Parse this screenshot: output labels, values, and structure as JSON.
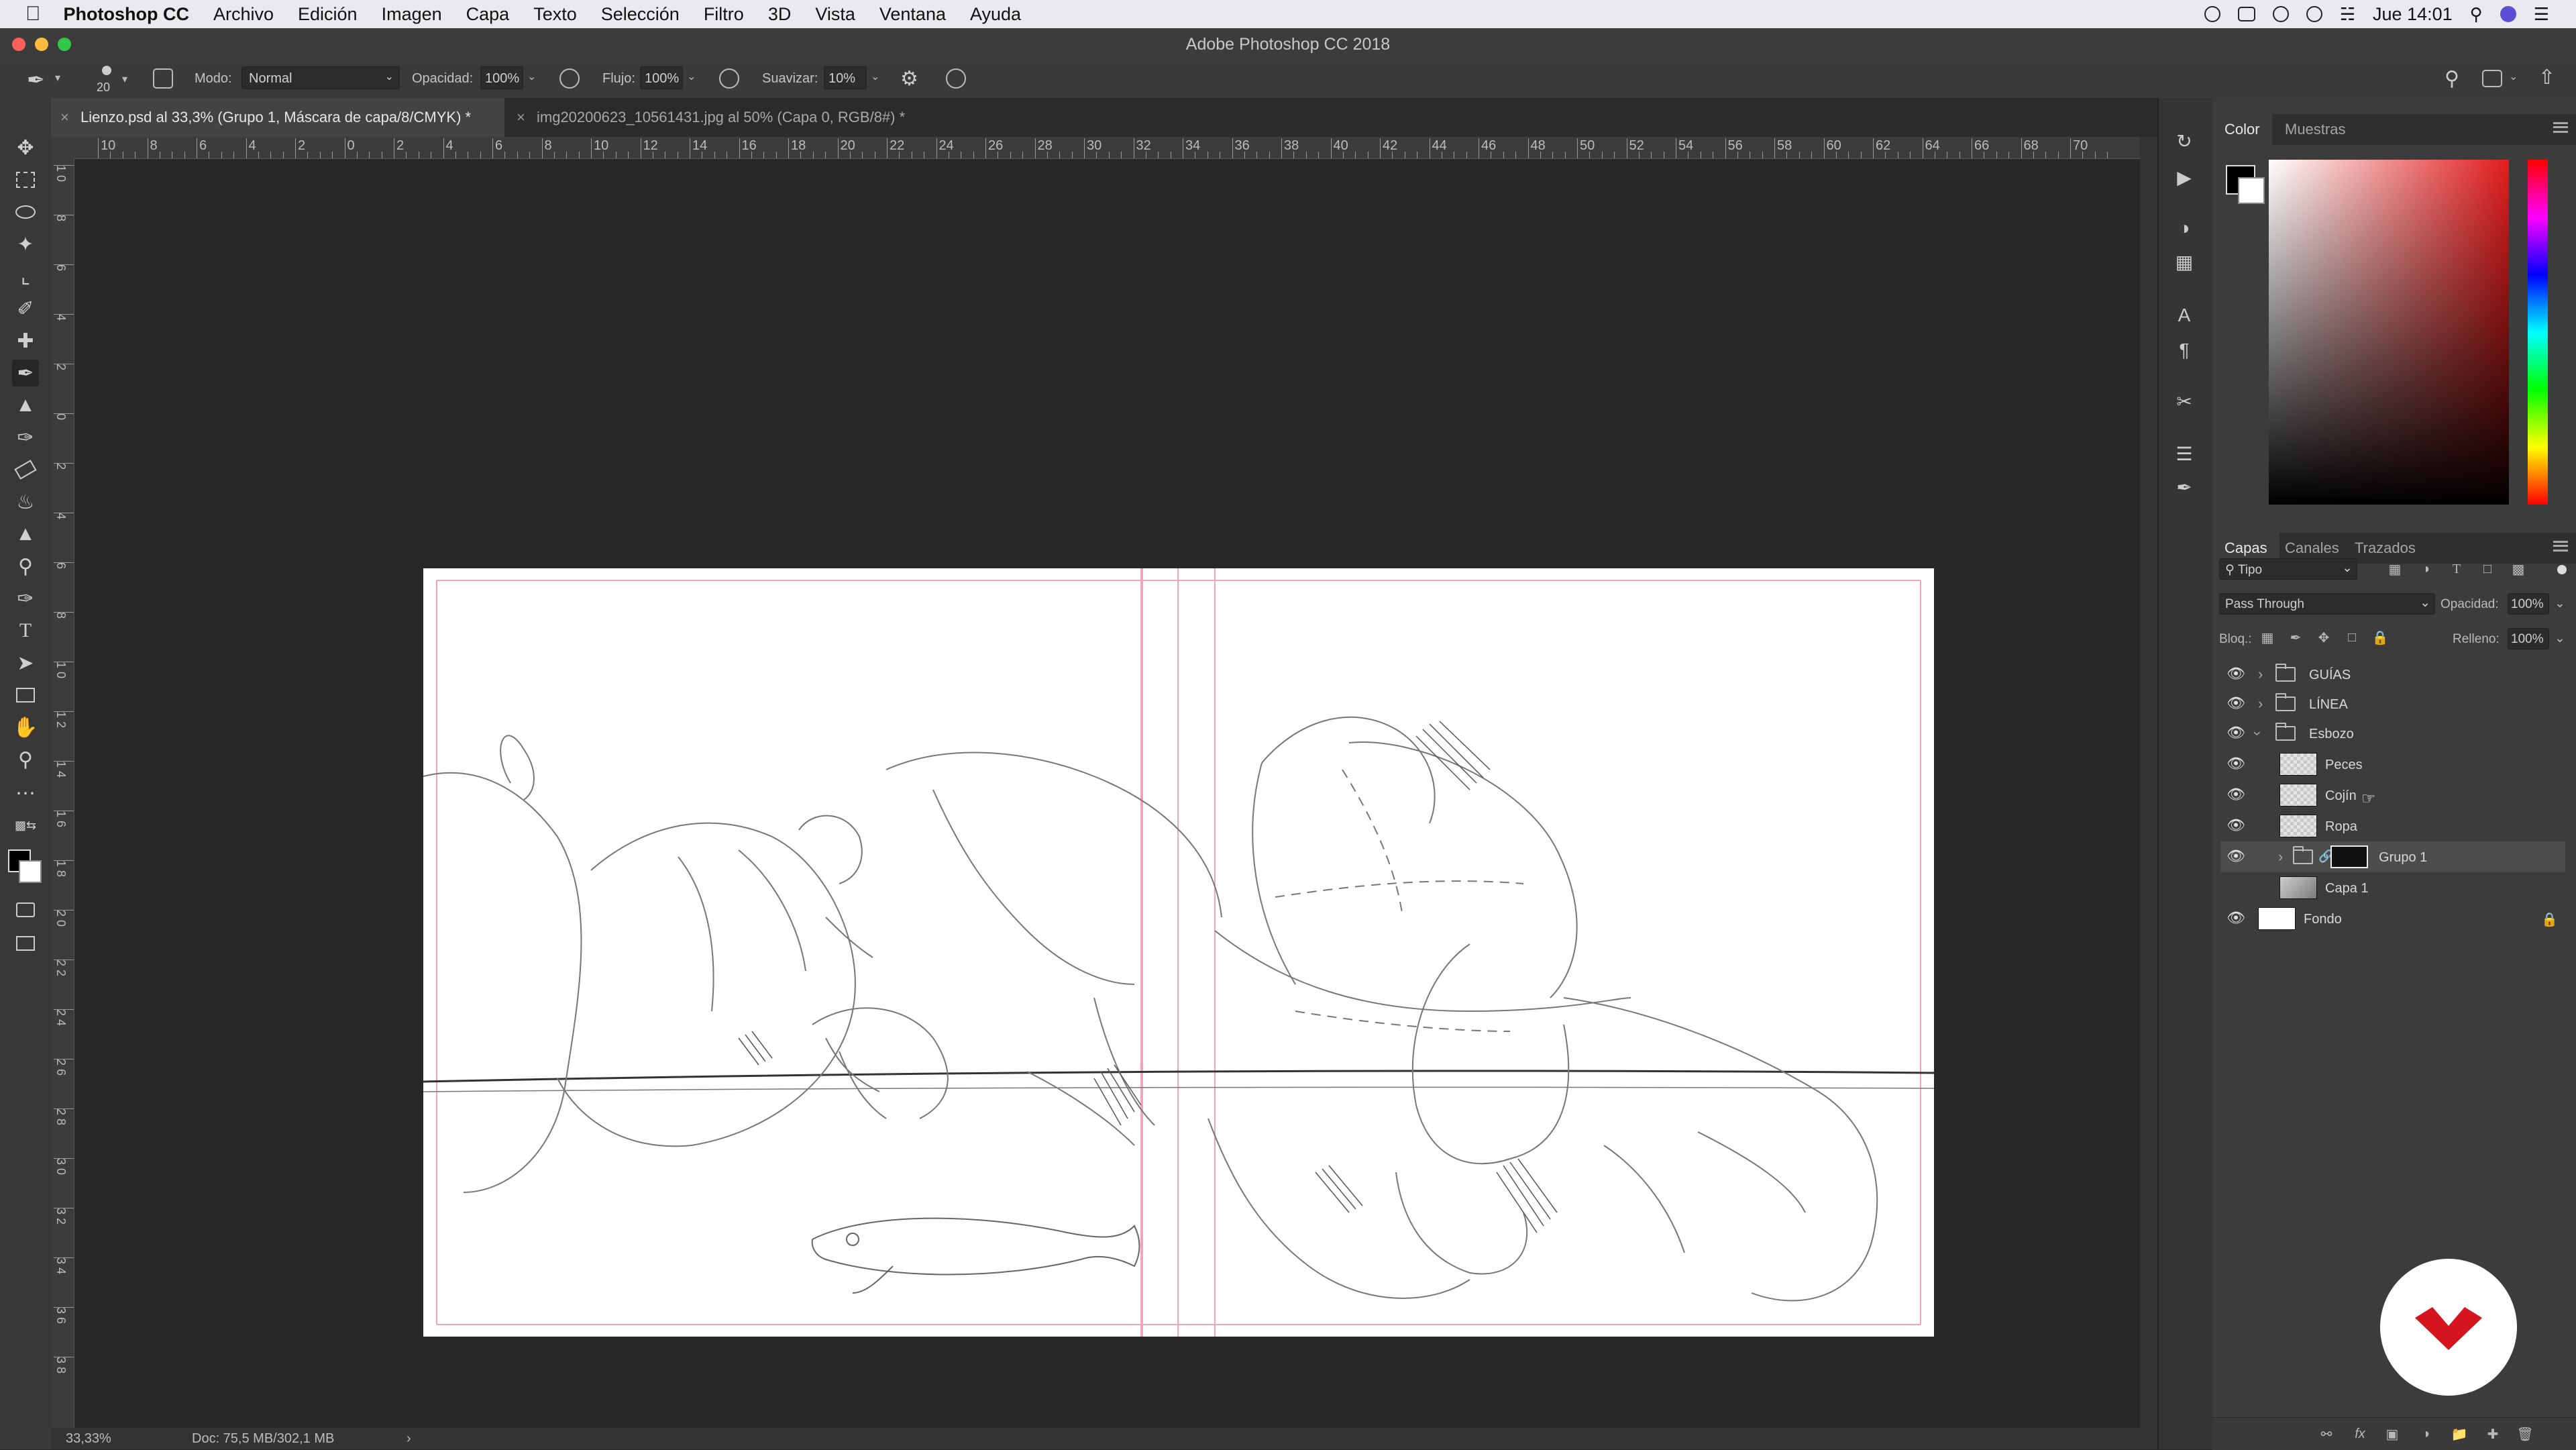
{
  "menubar": {
    "app_name": "Photoshop CC",
    "menus": [
      "Archivo",
      "Edición",
      "Imagen",
      "Capa",
      "Texto",
      "Selección",
      "Filtro",
      "3D",
      "Vista",
      "Ventana",
      "Ayuda"
    ],
    "clock": "Jue 14:01"
  },
  "window": {
    "title": "Adobe Photoshop CC 2018"
  },
  "options_bar": {
    "brush_size": "20",
    "mode_label": "Modo:",
    "mode_value": "Normal",
    "opacity_label": "Opacidad:",
    "opacity_value": "100%",
    "flow_label": "Flujo:",
    "flow_value": "100%",
    "smoothing_label": "Suavizar:",
    "smoothing_value": "10%"
  },
  "tabs": [
    {
      "label": "Lienzo.psd al 33,3% (Grupo 1, Máscara de capa/8/CMYK) *",
      "active": true
    },
    {
      "label": "img20200623_10561431.jpg al 50% (Capa 0, RGB/8#) *",
      "active": false
    }
  ],
  "ruler_top_labels": [
    "10",
    "8",
    "6",
    "4",
    "2",
    "0",
    "2",
    "4",
    "6",
    "8",
    "10",
    "12",
    "14",
    "16",
    "18",
    "20",
    "22",
    "24",
    "26",
    "28",
    "30",
    "32",
    "34",
    "36",
    "38",
    "40",
    "42",
    "44",
    "46",
    "48",
    "50",
    "52",
    "54",
    "56",
    "58",
    "60",
    "62",
    "64",
    "66",
    "68",
    "70"
  ],
  "ruler_left_labels": [
    "1 0",
    "8",
    "6",
    "4",
    "2",
    "0",
    "2",
    "4",
    "6",
    "8",
    "1 0",
    "1 2",
    "1 4",
    "1 6",
    "1 8",
    "2 0",
    "2 2",
    "2 4",
    "2 6",
    "2 8",
    "3 0",
    "3 2",
    "3 4",
    "3 6",
    "3 8"
  ],
  "status_bar": {
    "zoom": "33,33%",
    "doc_size": "Doc: 75,5 MB/302,1 MB"
  },
  "color_panel": {
    "tabs": [
      "Color",
      "Muestras"
    ],
    "foreground": "#000000",
    "background": "#ffffff",
    "hue_color": "#e31d1d"
  },
  "layers_panel": {
    "tabs": [
      "Capas",
      "Canales",
      "Trazados"
    ],
    "filter_kind": "Tipo",
    "blend_mode": "Pass Through",
    "opacity_label": "Opacidad:",
    "opacity_value": "100%",
    "lock_label": "Bloq.:",
    "fill_label": "Relleno:",
    "fill_value": "100%",
    "layers": [
      {
        "name": "GUÍAS",
        "type": "group",
        "visible": true,
        "expanded": false,
        "indent": 0
      },
      {
        "name": "LÍNEA",
        "type": "group",
        "visible": true,
        "expanded": false,
        "indent": 0
      },
      {
        "name": "Esbozo",
        "type": "group",
        "visible": true,
        "expanded": true,
        "indent": 0
      },
      {
        "name": "Peces",
        "type": "layer",
        "visible": true,
        "indent": 1
      },
      {
        "name": "Cojín",
        "type": "layer",
        "visible": true,
        "indent": 1
      },
      {
        "name": "Ropa",
        "type": "layer",
        "visible": true,
        "indent": 1
      },
      {
        "name": "Grupo 1",
        "type": "group-mask",
        "visible": true,
        "expanded": false,
        "indent": 1,
        "selected": true
      },
      {
        "name": "Capa 1",
        "type": "layer-image",
        "visible": false,
        "indent": 1
      },
      {
        "name": "Fondo",
        "type": "background",
        "visible": true,
        "locked": true,
        "indent": 0
      }
    ]
  },
  "brand_color": "#d4151d"
}
